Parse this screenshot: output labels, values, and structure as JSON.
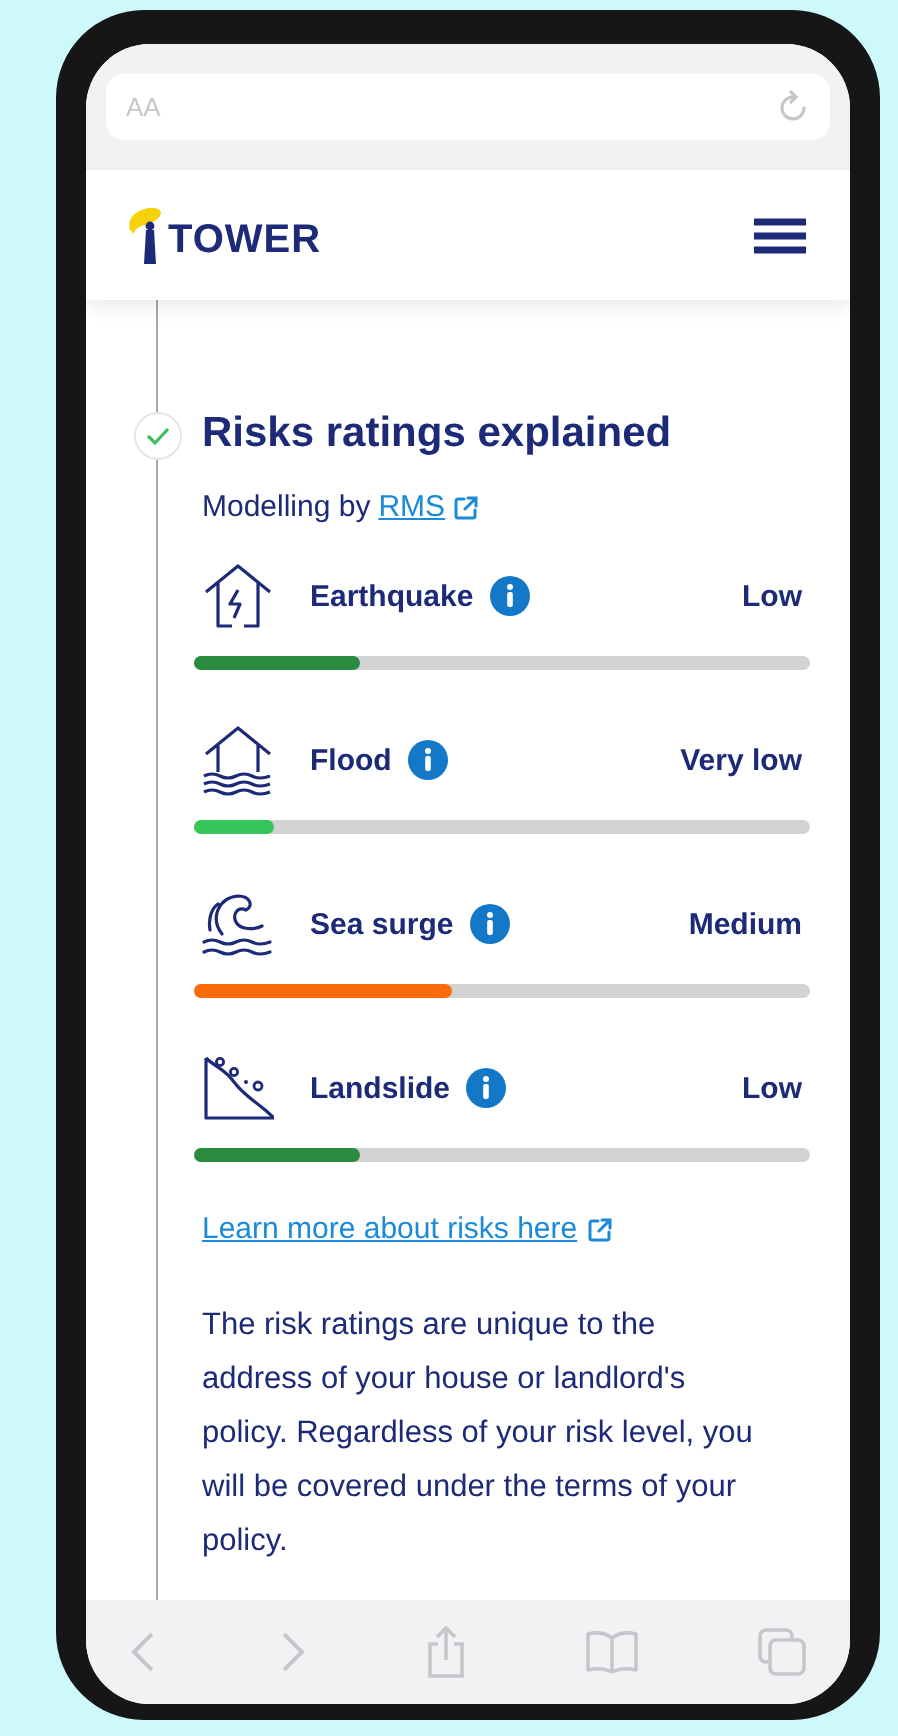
{
  "browser": {
    "address_text": "AA"
  },
  "header": {
    "logo_text": "TOWER"
  },
  "section": {
    "title": "Risks ratings explained",
    "completed": true,
    "source_prefix": "Modelling by",
    "source_link": "RMS"
  },
  "risks": [
    {
      "kind": "earthquake",
      "name": "Earthquake",
      "rating": "Low",
      "level": 0.27,
      "color": "#2a8a3e"
    },
    {
      "kind": "flood",
      "name": "Flood",
      "rating": "Very low",
      "level": 0.13,
      "color": "#35c659"
    },
    {
      "kind": "sea-surge",
      "name": "Sea surge",
      "rating": "Medium",
      "level": 0.42,
      "color": "#fb6a0a"
    },
    {
      "kind": "landslide",
      "name": "Landslide",
      "rating": "Low",
      "level": 0.27,
      "color": "#2a8a3e"
    }
  ],
  "learn_more_link": "Learn more about risks here",
  "explanation": "The risk ratings are unique to the address of your house or landlord's policy. Regardless of your risk level, you will be covered under the terms of your policy."
}
